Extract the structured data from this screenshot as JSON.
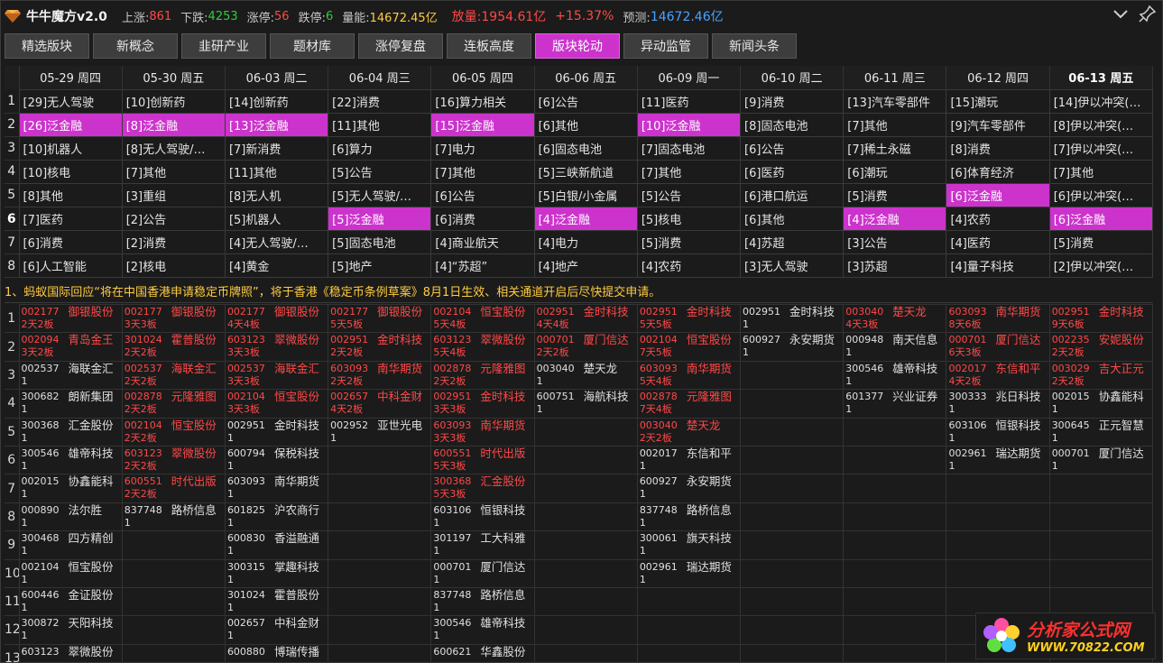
{
  "header": {
    "app_title": "牛牛魔方v2.0",
    "up_label": "上涨:",
    "up_val": "861",
    "down_label": "下跌:",
    "down_val": "4253",
    "limitup_label": "涨停:",
    "limitup_val": "56",
    "limitdown_label": "跌停:",
    "limitdown_val": "6",
    "volume_label": "量能:",
    "volume_val": "14672.45亿",
    "increase_label": "放量:",
    "increase_val": "1954.61亿",
    "increase_pct": "+15.37%",
    "forecast_label": "预测:",
    "forecast_val": "14672.46亿"
  },
  "tabs": [
    {
      "label": "精选版块"
    },
    {
      "label": "新概念"
    },
    {
      "label": "韭研产业"
    },
    {
      "label": "题材库"
    },
    {
      "label": "涨停复盘"
    },
    {
      "label": "连板高度"
    },
    {
      "label": "版块轮动",
      "active": true
    },
    {
      "label": "异动监管"
    },
    {
      "label": "新闻头条"
    }
  ],
  "dates": [
    "05-29 周四",
    "05-30 周五",
    "06-03 周二",
    "06-04 周三",
    "06-05 周四",
    "06-06 周五",
    "06-09 周一",
    "06-10 周二",
    "06-11 周三",
    "06-12 周四",
    "06-13 周五"
  ],
  "rotation": [
    [
      "[29]无人驾驶",
      "[10]创新药",
      "[14]创新药",
      "[22]消费",
      "[16]算力相关",
      "[6]公告",
      "[11]医药",
      "[9]消费",
      "[13]汽车零部件",
      "[15]潮玩",
      "[14]伊以冲突(…"
    ],
    [
      "[26]泛金融",
      "[8]泛金融",
      "[13]泛金融",
      "[11]其他",
      "[15]泛金融",
      "[6]其他",
      "[10]泛金融",
      "[8]固态电池",
      "[7]其他",
      "[9]汽车零部件",
      "[8]伊以冲突(…"
    ],
    [
      "[10]机器人",
      "[8]无人驾驶/…",
      "[7]新消费",
      "[6]算力",
      "[7]电力",
      "[6]固态电池",
      "[7]固态电池",
      "[6]公告",
      "[7]稀土永磁",
      "[8]消费",
      "[7]伊以冲突(…"
    ],
    [
      "[10]核电",
      "[7]其他",
      "[11]其他",
      "[5]公告",
      "[7]其他",
      "[5]三峡新航道",
      "[7]其他",
      "[6]医药",
      "[6]潮玩",
      "[6]体育经济",
      "[7]其他"
    ],
    [
      "[8]其他",
      "[3]重组",
      "[8]无人机",
      "[5]无人驾驶/…",
      "[6]公告",
      "[5]白银/小金属",
      "[5]公告",
      "[6]港口航运",
      "[5]消费",
      "[6]泛金融",
      "[6]伊以冲突(…"
    ],
    [
      "[7]医药",
      "[2]公告",
      "[5]机器人",
      "[5]泛金融",
      "[6]消费",
      "[4]泛金融",
      "[5]核电",
      "[6]其他",
      "[4]泛金融",
      "[4]农药",
      "[6]泛金融"
    ],
    [
      "[6]消费",
      "[2]消费",
      "[4]无人驾驶/…",
      "[5]固态电池",
      "[4]商业航天",
      "[4]电力",
      "[5]消费",
      "[4]苏超",
      "[3]公告",
      "[4]医药",
      "[5]消费"
    ],
    [
      "[6]人工智能",
      "[2]核电",
      "[4]黄金",
      "[5]地产",
      "[4]“苏超”",
      "[4]地产",
      "[4]农药",
      "[3]无人驾驶",
      "[3]苏超",
      "[4]量子科技",
      "[2]伊以冲突(…"
    ]
  ],
  "rotation_hl": [
    [
      1,
      0
    ],
    [
      1,
      1
    ],
    [
      1,
      2
    ],
    [
      1,
      4
    ],
    [
      1,
      6
    ],
    [
      5,
      3
    ],
    [
      5,
      5
    ],
    [
      5,
      8
    ],
    [
      5,
      10
    ],
    [
      4,
      9
    ]
  ],
  "news": "1、蚂蚁国际回应“将在中国香港申请稳定币牌照”，将于香港《稳定币条例草案》8月1日生效、相关通道开启后尽快提交申请。",
  "stocks": [
    [
      {
        "c": "002177",
        "n": "御银股份",
        "s": "2天2板",
        "r": 1
      },
      {
        "c": "002177",
        "n": "御银股份",
        "s": "3天3板",
        "r": 1
      },
      {
        "c": "002177",
        "n": "御银股份",
        "s": "4天4板",
        "r": 1
      },
      {
        "c": "002177",
        "n": "御银股份",
        "s": "5天5板",
        "r": 1
      },
      {
        "c": "002104",
        "n": "恒宝股份",
        "s": "5天4板",
        "r": 1
      },
      {
        "c": "002951",
        "n": "金时科技",
        "s": "4天4板",
        "r": 1
      },
      {
        "c": "002951",
        "n": "金时科技",
        "s": "5天5板",
        "r": 1
      },
      {
        "c": "002951",
        "n": "金时科技",
        "s": "1",
        "r": 0
      },
      {
        "c": "003040",
        "n": "楚天龙",
        "s": "4天3板",
        "r": 1
      },
      {
        "c": "603093",
        "n": "南华期货",
        "s": "8天6板",
        "r": 1
      },
      {
        "c": "002951",
        "n": "金时科技",
        "s": "9天6板",
        "r": 1
      }
    ],
    [
      {
        "c": "002094",
        "n": "青岛金王",
        "s": "3天2板",
        "r": 1
      },
      {
        "c": "301024",
        "n": "霍普股份",
        "s": "2天2板",
        "r": 1
      },
      {
        "c": "603123",
        "n": "翠微股份",
        "s": "3天3板",
        "r": 1
      },
      {
        "c": "002951",
        "n": "金时科技",
        "s": "2天2板",
        "r": 1
      },
      {
        "c": "603123",
        "n": "翠微股份",
        "s": "5天4板",
        "r": 1
      },
      {
        "c": "000701",
        "n": "厦门信达",
        "s": "2天2板",
        "r": 1
      },
      {
        "c": "002104",
        "n": "恒宝股份",
        "s": "7天5板",
        "r": 1
      },
      {
        "c": "600927",
        "n": "永安期货",
        "s": "1",
        "r": 0
      },
      {
        "c": "000948",
        "n": "南天信息",
        "s": "1",
        "r": 0
      },
      {
        "c": "000701",
        "n": "厦门信达",
        "s": "6天3板",
        "r": 1
      },
      {
        "c": "002235",
        "n": "安妮股份",
        "s": "2天2板",
        "r": 1
      }
    ],
    [
      {
        "c": "002537",
        "n": "海联金汇",
        "s": "1",
        "r": 0
      },
      {
        "c": "002537",
        "n": "海联金汇",
        "s": "2天2板",
        "r": 1
      },
      {
        "c": "002537",
        "n": "海联金汇",
        "s": "3天3板",
        "r": 1
      },
      {
        "c": "603093",
        "n": "南华期货",
        "s": "2天2板",
        "r": 1
      },
      {
        "c": "002878",
        "n": "元隆雅图",
        "s": "2天2板",
        "r": 1
      },
      {
        "c": "003040",
        "n": "楚天龙",
        "s": "1",
        "r": 0
      },
      {
        "c": "603093",
        "n": "南华期货",
        "s": "5天4板",
        "r": 1
      },
      null,
      {
        "c": "300546",
        "n": "雄帝科技",
        "s": "1",
        "r": 0
      },
      {
        "c": "002017",
        "n": "东信和平",
        "s": "4天2板",
        "r": 1
      },
      {
        "c": "003029",
        "n": "吉大正元",
        "s": "2天2板",
        "r": 1
      }
    ],
    [
      {
        "c": "300682",
        "n": "朗新集团",
        "s": "1",
        "r": 0
      },
      {
        "c": "002878",
        "n": "元隆雅图",
        "s": "2天2板",
        "r": 1
      },
      {
        "c": "002104",
        "n": "恒宝股份",
        "s": "3天3板",
        "r": 1
      },
      {
        "c": "002657",
        "n": "中科金财",
        "s": "4天2板",
        "r": 1
      },
      {
        "c": "002951",
        "n": "金时科技",
        "s": "3天3板",
        "r": 1
      },
      {
        "c": "600751",
        "n": "海航科技",
        "s": "1",
        "r": 0
      },
      {
        "c": "002878",
        "n": "元隆雅图",
        "s": "7天4板",
        "r": 1
      },
      null,
      {
        "c": "601377",
        "n": "兴业证券",
        "s": "1",
        "r": 0
      },
      {
        "c": "300333",
        "n": "兆日科技",
        "s": "1",
        "r": 0
      },
      {
        "c": "002015",
        "n": "协鑫能科",
        "s": "1",
        "r": 0
      }
    ],
    [
      {
        "c": "300368",
        "n": "汇金股份",
        "s": "1",
        "r": 0
      },
      {
        "c": "002104",
        "n": "恒宝股份",
        "s": "2天2板",
        "r": 1
      },
      {
        "c": "002951",
        "n": "金时科技",
        "s": "1",
        "r": 0
      },
      {
        "c": "002952",
        "n": "亚世光电",
        "s": "1",
        "r": 0
      },
      {
        "c": "603093",
        "n": "南华期货",
        "s": "3天3板",
        "r": 1
      },
      null,
      {
        "c": "003040",
        "n": "楚天龙",
        "s": "2天2板",
        "r": 1
      },
      null,
      null,
      {
        "c": "603106",
        "n": "恒银科技",
        "s": "1",
        "r": 0
      },
      {
        "c": "300645",
        "n": "正元智慧",
        "s": "1",
        "r": 0
      }
    ],
    [
      {
        "c": "300546",
        "n": "雄帝科技",
        "s": "1",
        "r": 0
      },
      {
        "c": "603123",
        "n": "翠微股份",
        "s": "2天2板",
        "r": 1
      },
      {
        "c": "600794",
        "n": "保税科技",
        "s": "1",
        "r": 0
      },
      null,
      {
        "c": "600551",
        "n": "时代出版",
        "s": "5天3板",
        "r": 1
      },
      null,
      {
        "c": "002017",
        "n": "东信和平",
        "s": "1",
        "r": 0
      },
      null,
      null,
      {
        "c": "002961",
        "n": "瑞达期货",
        "s": "1",
        "r": 0
      },
      {
        "c": "000701",
        "n": "厦门信达",
        "s": "1",
        "r": 0
      }
    ],
    [
      {
        "c": "002015",
        "n": "协鑫能科",
        "s": "1",
        "r": 0
      },
      {
        "c": "600551",
        "n": "时代出版",
        "s": "2天2板",
        "r": 1
      },
      {
        "c": "603093",
        "n": "南华期货",
        "s": "1",
        "r": 0
      },
      null,
      {
        "c": "300368",
        "n": "汇金股份",
        "s": "5天3板",
        "r": 1
      },
      null,
      {
        "c": "600927",
        "n": "永安期货",
        "s": "1",
        "r": 0
      },
      null,
      null,
      null,
      null
    ],
    [
      {
        "c": "000890",
        "n": "法尔胜",
        "s": "1",
        "r": 0
      },
      {
        "c": "837748",
        "n": "路桥信息",
        "s": "1",
        "r": 0
      },
      {
        "c": "601825",
        "n": "沪农商行",
        "s": "1",
        "r": 0
      },
      null,
      {
        "c": "603106",
        "n": "恒银科技",
        "s": "1",
        "r": 0
      },
      null,
      {
        "c": "837748",
        "n": "路桥信息",
        "s": "1",
        "r": 0
      },
      null,
      null,
      null,
      null
    ],
    [
      {
        "c": "300468",
        "n": "四方精创",
        "s": "1",
        "r": 0
      },
      null,
      {
        "c": "600830",
        "n": "香溢融通",
        "s": "1",
        "r": 0
      },
      null,
      {
        "c": "301197",
        "n": "工大科雅",
        "s": "1",
        "r": 0
      },
      null,
      {
        "c": "300061",
        "n": "旗天科技",
        "s": "1",
        "r": 0
      },
      null,
      null,
      null,
      null
    ],
    [
      {
        "c": "002104",
        "n": "恒宝股份",
        "s": "1",
        "r": 0
      },
      null,
      {
        "c": "300315",
        "n": "掌趣科技",
        "s": "1",
        "r": 0
      },
      null,
      {
        "c": "000701",
        "n": "厦门信达",
        "s": "1",
        "r": 0
      },
      null,
      {
        "c": "002961",
        "n": "瑞达期货",
        "s": "1",
        "r": 0
      },
      null,
      null,
      null,
      null
    ],
    [
      {
        "c": "600446",
        "n": "金证股份",
        "s": "1",
        "r": 0
      },
      null,
      {
        "c": "301024",
        "n": "霍普股份",
        "s": "1",
        "r": 0
      },
      null,
      {
        "c": "837748",
        "n": "路桥信息",
        "s": "1",
        "r": 0
      },
      null,
      null,
      null,
      null,
      null,
      null
    ],
    [
      {
        "c": "300872",
        "n": "天阳科技",
        "s": "1",
        "r": 0
      },
      null,
      {
        "c": "002657",
        "n": "中科金财",
        "s": "1",
        "r": 0
      },
      null,
      {
        "c": "300546",
        "n": "雄帝科技",
        "s": "1",
        "r": 0
      },
      null,
      null,
      null,
      null,
      null,
      null
    ],
    [
      {
        "c": "603123",
        "n": "翠微股份",
        "s": "",
        "r": 0
      },
      null,
      {
        "c": "600880",
        "n": "博瑞传播",
        "s": "",
        "r": 0
      },
      null,
      {
        "c": "600621",
        "n": "华鑫股份",
        "s": "",
        "r": 0
      },
      null,
      null,
      null,
      null,
      null,
      null
    ]
  ],
  "watermark": {
    "title": "分析家公式网",
    "url": "WWW.70822.COM"
  },
  "colors": {
    "accent": "#cc33cc",
    "limit_red": "#ff4848",
    "news_gold": "#ffcc40"
  }
}
